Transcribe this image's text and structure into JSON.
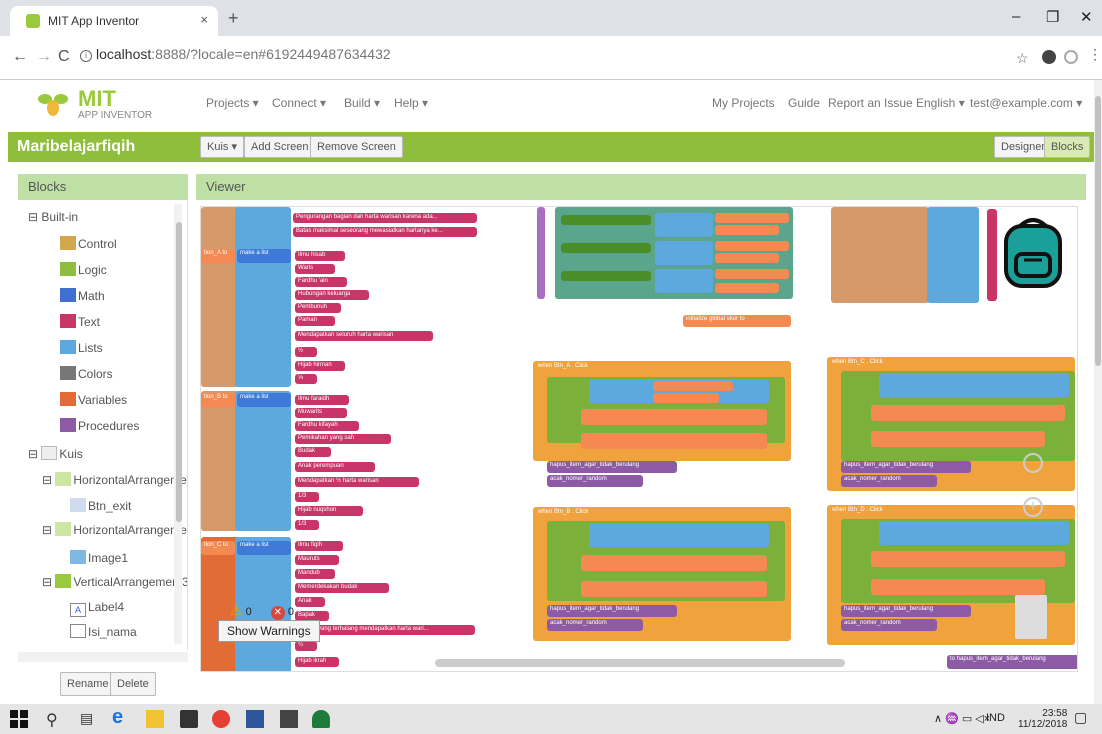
{
  "browser": {
    "tab_title": "MIT App Inventor",
    "url_host": "localhost",
    "url_rest": ":8888/?locale=en#6192449487634432"
  },
  "app": {
    "logo_text": "MIT",
    "logo_sub": "APP INVENTOR",
    "menu": [
      "Projects ▾",
      "Connect ▾",
      "Build ▾",
      "Help ▾"
    ],
    "right_menu": [
      "My Projects",
      "Guide",
      "Report an Issue",
      "English ▾",
      "test@example.com ▾"
    ]
  },
  "toolbar": {
    "project_name": "Maribelajarfiqih",
    "screen_select": "Kuis ▾",
    "add_screen": "Add Screen ...",
    "remove_screen": "Remove Screen",
    "designer": "Designer",
    "blocks": "Blocks"
  },
  "blocks_panel": {
    "title": "Blocks",
    "builtin": "Built-in",
    "categories": [
      {
        "label": "Control",
        "color": "#d3a84d"
      },
      {
        "label": "Logic",
        "color": "#8fbe3c"
      },
      {
        "label": "Math",
        "color": "#3f6fd1"
      },
      {
        "label": "Text",
        "color": "#c93568"
      },
      {
        "label": "Lists",
        "color": "#5da8dd"
      },
      {
        "label": "Colors",
        "color": "#777777"
      },
      {
        "label": "Variables",
        "color": "#e36b35"
      },
      {
        "label": "Procedures",
        "color": "#8d5aa5"
      }
    ],
    "components": [
      {
        "label": "Kuis",
        "level": 0
      },
      {
        "label": "HorizontalArrangemer",
        "level": 1
      },
      {
        "label": "Btn_exit",
        "level": 2
      },
      {
        "label": "HorizontalArrangemer",
        "level": 1
      },
      {
        "label": "Image1",
        "level": 2
      },
      {
        "label": "VerticalArrangement3",
        "level": 1
      },
      {
        "label": "Label4",
        "level": 2
      },
      {
        "label": "Isi_nama",
        "level": 2
      }
    ],
    "rename": "Rename",
    "delete": "Delete"
  },
  "viewer": {
    "title": "Viewer",
    "warnings_count": "0",
    "errors_count": "0",
    "show_warnings": "Show Warnings"
  },
  "blocks_text": {
    "text_a": [
      "Pengurangan bagian dan harta warisan karena ada...",
      "Batas maksimal seseorang mewasiatkan hartanya ke..."
    ],
    "list_a": [
      "Ilmu hisab",
      "Waris",
      "Fardhu 'ain",
      "Hubungan keluarga",
      "Pembunuh",
      "Paman",
      "Mendapatkan seluruh harta warisan",
      "½",
      "Hijab hirman",
      "⅓"
    ],
    "list_b": [
      "Ilmu faraidh",
      "Muwarits",
      "Fardhu kifayah",
      "Pemikahan yang sah",
      "Budak",
      "Anak perempuan",
      "Mendapatkan ½ harta warisan",
      "1/3",
      "Hijab nuqshon",
      "1/3"
    ],
    "list_c": [
      "Ilmu fiqih",
      "Mauruts",
      "Mandub",
      "Memerdekakan budak",
      "Anak",
      "Bapak",
      "li waris yang terhalang mendapatkan harta wari...",
      "¼",
      "Hijab ikrah"
    ],
    "labels": {
      "make_a_list": "make a list",
      "opt_a": "tion_A to",
      "opt_b": "tion_B to",
      "opt_c": "tion_C to",
      "init_global": "initialize global skor to",
      "when_a": "when Btn_A . Click",
      "when_b": "when Btn_B . Click",
      "when_c": "when Btn_C . Click",
      "when_d": "when Btn_D . Click",
      "hapus": "hapus_item_agar_tidak_berulang",
      "acak": "acak_nomer_random",
      "to_hapus": "to hapus_item_agar_tidak_berulang"
    }
  },
  "taskbar": {
    "lang": "IND",
    "time": "23:58",
    "date": "11/12/2018"
  }
}
